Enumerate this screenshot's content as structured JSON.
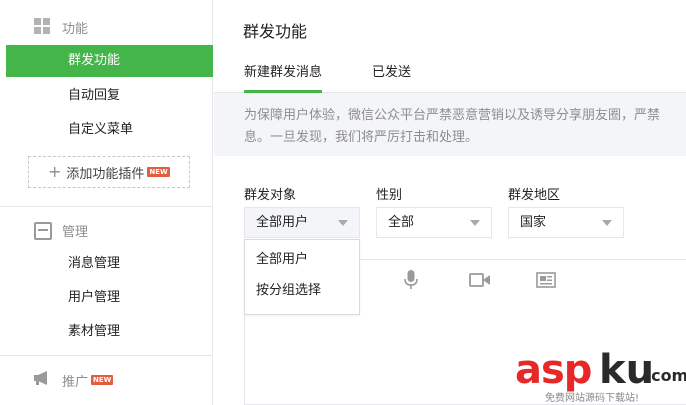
{
  "sidebar": {
    "section_features": {
      "label": "功能",
      "icon": "grid-icon"
    },
    "items_features": [
      {
        "label": "群发功能",
        "active": true
      },
      {
        "label": "自动回复"
      },
      {
        "label": "自定义菜单"
      }
    ],
    "add_plugin": {
      "label": "添加功能插件",
      "badge": "NEW"
    },
    "section_manage": {
      "label": "管理",
      "icon": "inbox-icon"
    },
    "items_manage": [
      {
        "label": "消息管理"
      },
      {
        "label": "用户管理"
      },
      {
        "label": "素材管理"
      }
    ],
    "section_promote": {
      "label": "推广",
      "icon": "megaphone-icon",
      "badge": "NEW"
    }
  },
  "main": {
    "title": "群发功能",
    "tabs": [
      {
        "label": "新建群发消息",
        "active": true
      },
      {
        "label": "已发送"
      }
    ],
    "notice_line1": "为保障用户体验，微信公众平台严禁恶意营销以及诱导分享朋友圈，严禁",
    "notice_line2": "息。一旦发现，我们将严厉打击和处理。",
    "fields": {
      "target": {
        "label": "群发对象",
        "value": "全部用户"
      },
      "gender": {
        "label": "性别",
        "value": "全部"
      },
      "region": {
        "label": "群发地区",
        "value": "国家"
      }
    },
    "target_options": [
      "全部用户",
      "按分组选择"
    ],
    "toolbar_icons": [
      "microphone-icon",
      "video-icon",
      "news-card-icon"
    ]
  },
  "watermark": {
    "brand_red": "asp",
    "brand_dark": "ku",
    "brand_suffix": ".com",
    "subtitle": "免费网站源码下载站!"
  },
  "colors": {
    "accent": "#44b549",
    "badge": "#e15f3f",
    "watermark_red": "#e62828"
  }
}
